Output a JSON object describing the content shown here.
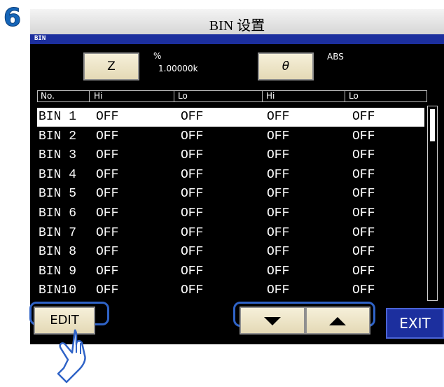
{
  "step_number": "6",
  "title": "BIN 设置",
  "screen_label": "BIN",
  "z_button": {
    "label": "Z"
  },
  "z_info": {
    "unit": "%",
    "value": "1.00000k"
  },
  "theta_button": {
    "label": "θ"
  },
  "theta_info": {
    "mode": "ABS"
  },
  "table": {
    "headers": [
      "No.",
      "Hi",
      "Lo",
      "Hi",
      "Lo"
    ],
    "rows": [
      {
        "no": "BIN 1",
        "z_hi": "OFF",
        "z_lo": "OFF",
        "t_hi": "OFF",
        "t_lo": "OFF"
      },
      {
        "no": "BIN 2",
        "z_hi": "OFF",
        "z_lo": "OFF",
        "t_hi": "OFF",
        "t_lo": "OFF"
      },
      {
        "no": "BIN 3",
        "z_hi": "OFF",
        "z_lo": "OFF",
        "t_hi": "OFF",
        "t_lo": "OFF"
      },
      {
        "no": "BIN 4",
        "z_hi": "OFF",
        "z_lo": "OFF",
        "t_hi": "OFF",
        "t_lo": "OFF"
      },
      {
        "no": "BIN 5",
        "z_hi": "OFF",
        "z_lo": "OFF",
        "t_hi": "OFF",
        "t_lo": "OFF"
      },
      {
        "no": "BIN 6",
        "z_hi": "OFF",
        "z_lo": "OFF",
        "t_hi": "OFF",
        "t_lo": "OFF"
      },
      {
        "no": "BIN 7",
        "z_hi": "OFF",
        "z_lo": "OFF",
        "t_hi": "OFF",
        "t_lo": "OFF"
      },
      {
        "no": "BIN 8",
        "z_hi": "OFF",
        "z_lo": "OFF",
        "t_hi": "OFF",
        "t_lo": "OFF"
      },
      {
        "no": "BIN 9",
        "z_hi": "OFF",
        "z_lo": "OFF",
        "t_hi": "OFF",
        "t_lo": "OFF"
      },
      {
        "no": "BIN10",
        "z_hi": "OFF",
        "z_lo": "OFF",
        "t_hi": "OFF",
        "t_lo": "OFF"
      }
    ],
    "selected_row": 0
  },
  "buttons": {
    "edit": "EDIT",
    "exit": "EXIT"
  },
  "icons": {
    "down": "arrow-down-icon",
    "up": "arrow-up-icon",
    "hand": "pointing-hand-icon"
  },
  "colors": {
    "accent": "#1c2f9e",
    "highlight": "#2f63c7",
    "step": "#1565b8"
  }
}
